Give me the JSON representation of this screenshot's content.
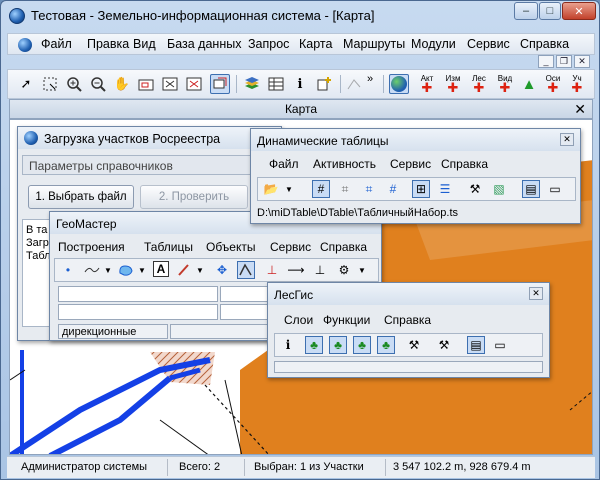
{
  "app": {
    "title": "Тестовая - Земельно-информационная система - [Карта]",
    "btn_min": "–",
    "btn_max": "□",
    "btn_close": "✕"
  },
  "menu": [
    "Файл",
    "Правка",
    "Вид",
    "База данных",
    "Запрос",
    "Карта",
    "Маршруты",
    "Модули",
    "Сервис",
    "Справка"
  ],
  "toolbar": {
    "plugin_labels": [
      "Акт",
      "Изм",
      "Лес",
      "Вид",
      "Оси",
      "Уч"
    ],
    "more": "»"
  },
  "mdi": {
    "title": "Карта",
    "close": "✕",
    "child_min": "_",
    "child_restore": "❐",
    "child_close": "✕"
  },
  "load_window": {
    "title": "Загрузка участков Росреестра",
    "group_label": "Параметры справочников",
    "btn_select": "1. Выбрать файл",
    "btn_check": "2. Проверить",
    "log_lines": [
      "В та",
      "Загр",
      "Табл"
    ]
  },
  "dyn_tables": {
    "title": "Динамические таблицы",
    "menu": [
      "Файл",
      "Активность",
      "Сервис",
      "Справка"
    ],
    "path": "D:\\miDTable\\DTable\\ТабличныйНабор.ts",
    "close": "✕"
  },
  "geomaster": {
    "title": "ГеоМастер",
    "menu": [
      "Построения",
      "Таблицы",
      "Объекты",
      "Сервис",
      "Справка"
    ],
    "status_left": "дирекционные",
    "close": "✕"
  },
  "lesgis": {
    "title": "ЛесГис",
    "menu": [
      "Слои",
      "Функции",
      "Справка"
    ],
    "close": "✕"
  },
  "status": {
    "user": "Администратор системы",
    "total": "Всего: 2",
    "selected": "Выбран: 1 из Участки",
    "coords": "3 547 102.2 m, 928 679.4 m"
  }
}
